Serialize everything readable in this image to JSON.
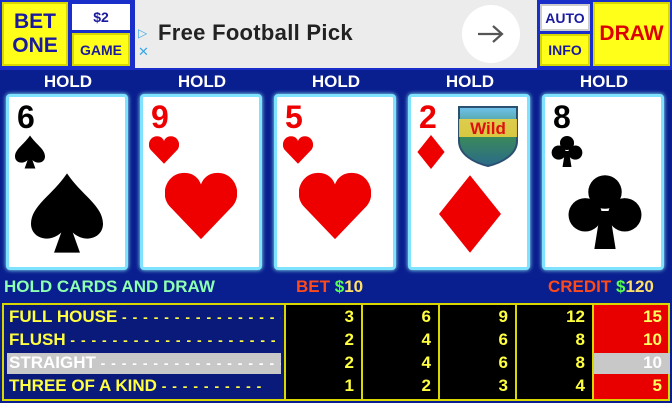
{
  "top": {
    "bet_one_line1": "BET",
    "bet_one_line2": "ONE",
    "bet_amount": "$2",
    "game_label": "GAME",
    "auto_label": "AUTO",
    "info_label": "INFO",
    "draw_label": "DRAW"
  },
  "ad": {
    "text": "Free Football Pick",
    "arrow_icon": "arrow-right-icon"
  },
  "hold_label": "HOLD",
  "cards": [
    {
      "rank": "6",
      "suit": "spades",
      "color": "black"
    },
    {
      "rank": "9",
      "suit": "hearts",
      "color": "red"
    },
    {
      "rank": "5",
      "suit": "hearts",
      "color": "red"
    },
    {
      "rank": "2",
      "suit": "diamonds",
      "color": "red",
      "badge": "Wild"
    },
    {
      "rank": "8",
      "suit": "clubs",
      "color": "black"
    }
  ],
  "status": {
    "message": "HOLD CARDS AND DRAW",
    "bet_label": "BET",
    "bet_currency": "$",
    "bet_value": "10",
    "credit_label": "CREDIT",
    "credit_currency": "$",
    "credit_value": "120"
  },
  "paytable": {
    "hands": [
      "FULL HOUSE",
      "FLUSH",
      "STRAIGHT",
      "THREE OF A KIND"
    ],
    "selected_hand": "STRAIGHT",
    "columns": [
      [
        "3",
        "2",
        "2",
        "1"
      ],
      [
        "6",
        "4",
        "4",
        "2"
      ],
      [
        "9",
        "6",
        "6",
        "3"
      ],
      [
        "12",
        "8",
        "8",
        "4"
      ],
      [
        "15",
        "10",
        "10",
        "5"
      ]
    ],
    "highlighted_column": 5
  },
  "colors": {
    "background": "#0a1f8f",
    "button_yellow": "#ffff1a",
    "card_border": "#7fe3ff",
    "highlight_red": "#e80000"
  }
}
